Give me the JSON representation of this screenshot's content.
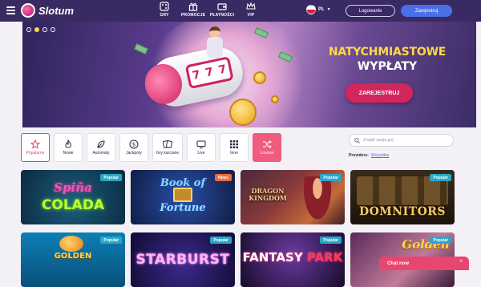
{
  "header": {
    "logo_text": "Slotum",
    "nav": [
      {
        "label": "GRY",
        "icon": "games-icon"
      },
      {
        "label": "PROMOCJE",
        "icon": "gift-icon"
      },
      {
        "label": "PŁATNOŚCI",
        "icon": "wallet-icon"
      },
      {
        "label": "VIP",
        "icon": "crown-icon"
      }
    ],
    "language": "PL",
    "login_label": "Logowanie",
    "register_label": "Zarejestruj"
  },
  "hero": {
    "title": "NATYCHMIASTOWE",
    "subtitle": "WYPŁATY",
    "cta_label": "ZAREJESTRUJ",
    "slot_reels": [
      "7",
      "7",
      "7"
    ],
    "slides": 4,
    "active_slide": 2
  },
  "categories": [
    {
      "label": "Popularne",
      "icon": "star-icon",
      "state": "selected"
    },
    {
      "label": "Nowe",
      "icon": "flame-icon",
      "state": "normal"
    },
    {
      "label": "Automaty",
      "icon": "leaf-icon",
      "state": "normal"
    },
    {
      "label": "Jackpoty",
      "icon": "dollar-icon",
      "state": "normal"
    },
    {
      "label": "Gry karciane",
      "icon": "cards-icon",
      "state": "normal"
    },
    {
      "label": "Live",
      "icon": "monitor-icon",
      "state": "normal"
    },
    {
      "label": "Inne",
      "icon": "grid-icon",
      "state": "normal"
    },
    {
      "label": "Losowe",
      "icon": "shuffle-icon",
      "state": "highlight"
    }
  ],
  "search": {
    "placeholder": "Znajdź swoją grę"
  },
  "providers": {
    "label": "Providers:",
    "value": "Wszystkie"
  },
  "games": [
    {
      "title": "Spiña",
      "title2": "COLADA",
      "badge": "Popular"
    },
    {
      "title": "Book of",
      "title2": "Fortune",
      "badge": "News"
    },
    {
      "title": "DRAGON KINGDOM",
      "badge": "Popular"
    },
    {
      "title": "DOMNITORS",
      "badge": "Popular"
    },
    {
      "title": "GOLDEN",
      "badge": "Popular"
    },
    {
      "title": "STARBURST",
      "badge": "Popular"
    },
    {
      "title": "FANTASY",
      "title2": "PARK",
      "badge": "Popular"
    },
    {
      "title": "Golden",
      "badge": "Popular"
    }
  ],
  "chat": {
    "label": "Chat now",
    "chevron": "^"
  },
  "colors": {
    "header_bg": "#3a2a63",
    "accent_pink": "#e0446c",
    "register_blue": "#4a6fe8",
    "title_gold": "#ffd84a"
  }
}
